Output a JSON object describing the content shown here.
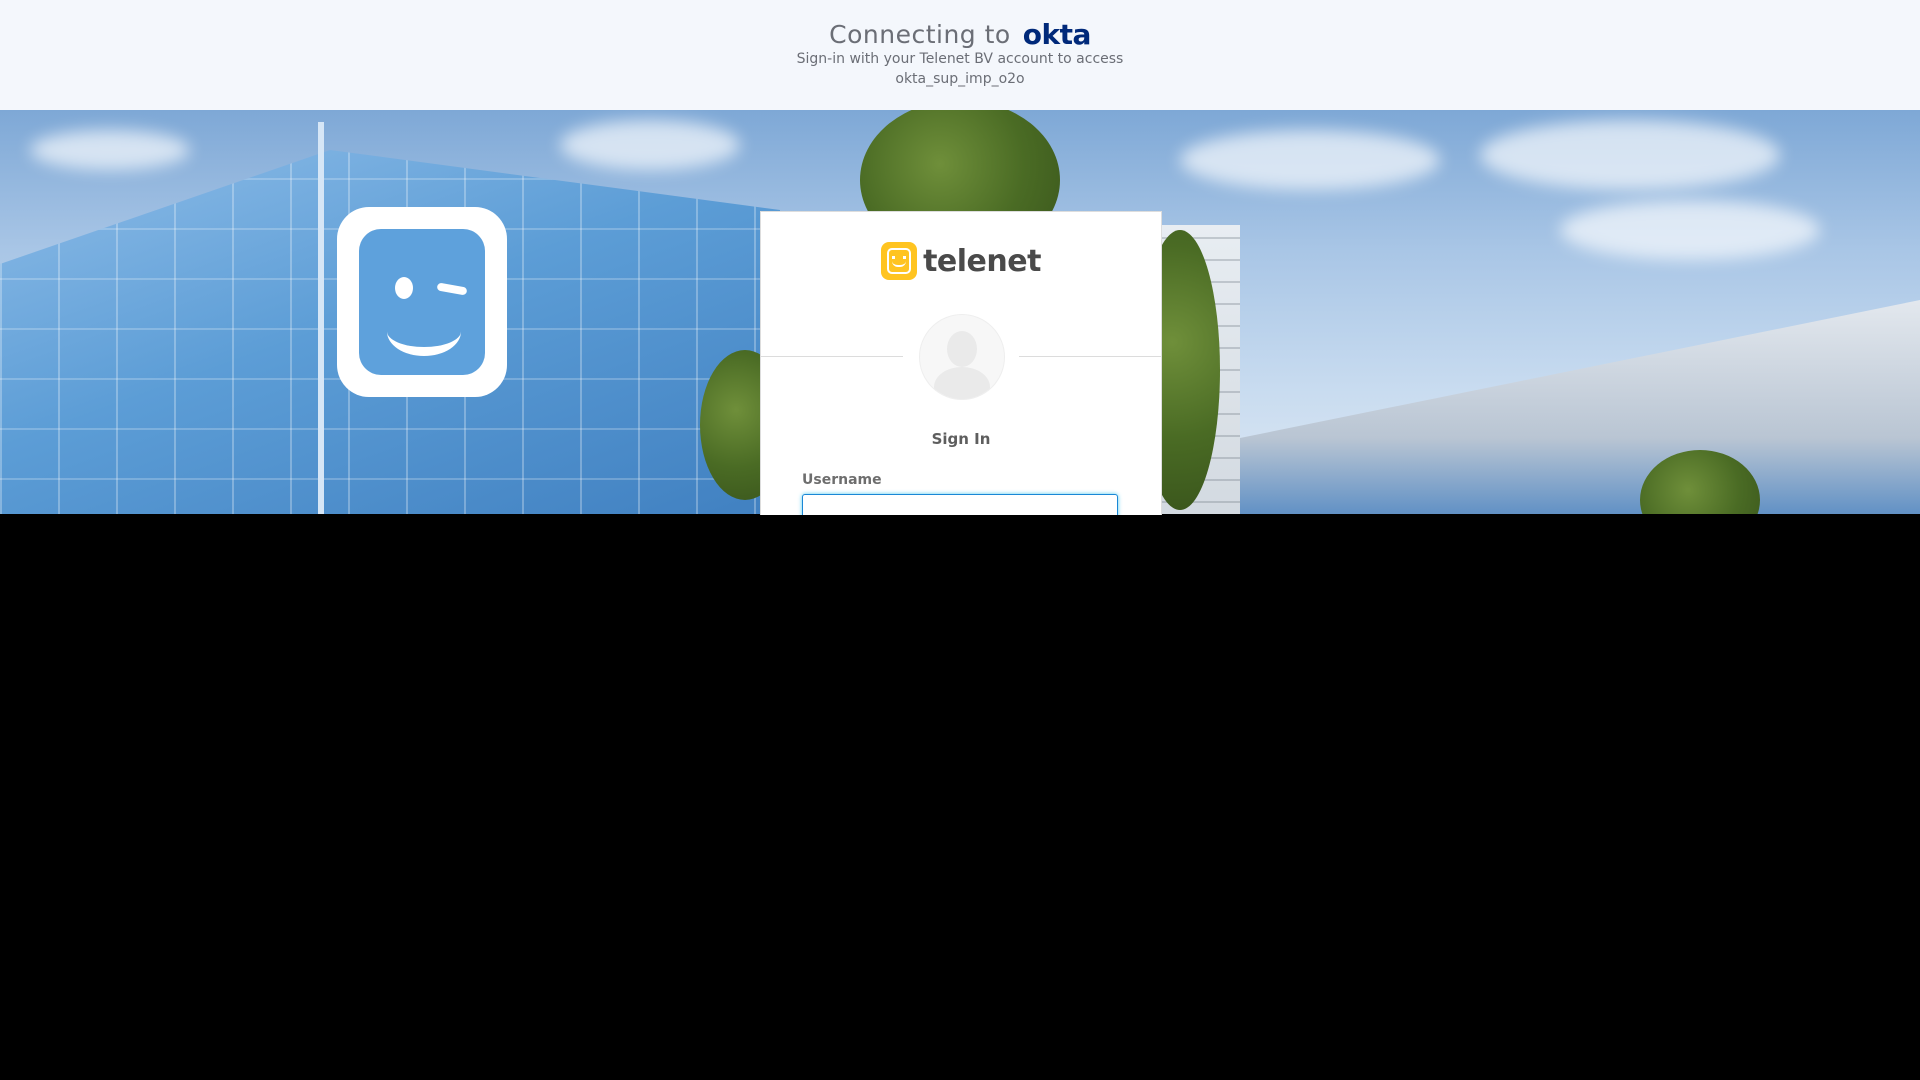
{
  "header": {
    "connecting_text": "Connecting to",
    "okta_logo": "okta",
    "subtitle_line1": "Sign-in with your Telenet BV account to access",
    "subtitle_line2": "okta_sup_imp_o2o"
  },
  "card": {
    "brand_name": "telenet",
    "title": "Sign In",
    "username_label": "Username",
    "username_value": ""
  },
  "colors": {
    "okta_blue": "#00297a",
    "telenet_yellow": "#ffc421",
    "input_focus": "#1a87d6"
  }
}
